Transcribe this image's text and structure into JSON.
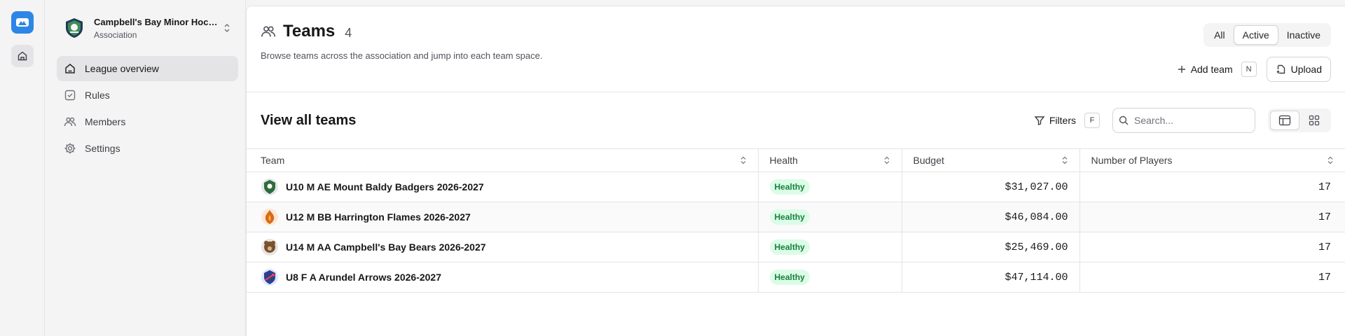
{
  "org": {
    "name": "Campbell's Bay Minor Hockey Association",
    "type": "Association"
  },
  "nav": [
    {
      "label": "League overview",
      "icon": "home-icon",
      "active": true
    },
    {
      "label": "Rules",
      "icon": "check-square-icon",
      "active": false
    },
    {
      "label": "Members",
      "icon": "users-icon",
      "active": false
    },
    {
      "label": "Settings",
      "icon": "gear-icon",
      "active": false
    }
  ],
  "header": {
    "title": "Teams",
    "count": "4",
    "subtitle": "Browse teams across the association and jump into each team space.",
    "status_filters": [
      "All",
      "Active",
      "Inactive"
    ],
    "active_status": "Active",
    "add_team_label": "Add team",
    "add_team_shortcut": "N",
    "upload_label": "Upload"
  },
  "toolbar": {
    "title": "View all teams",
    "filters_label": "Filters",
    "filters_shortcut": "F",
    "search_placeholder": "Search..."
  },
  "table": {
    "columns": [
      "Team",
      "Health",
      "Budget",
      "Number of Players"
    ],
    "rows": [
      {
        "team": "U10 M AE Mount Baldy Badgers 2026-2027",
        "health": "Healthy",
        "budget": "$31,027.00",
        "players": "17",
        "logo_color": "#2f6b3a"
      },
      {
        "team": "U12 M BB Harrington Flames 2026-2027",
        "health": "Healthy",
        "budget": "$46,084.00",
        "players": "17",
        "logo_color": "#d9681e"
      },
      {
        "team": "U14 M AA Campbell's Bay Bears 2026-2027",
        "health": "Healthy",
        "budget": "$25,469.00",
        "players": "17",
        "logo_color": "#7a5230"
      },
      {
        "team": "U8 F A Arundel Arrows 2026-2027",
        "health": "Healthy",
        "budget": "$47,114.00",
        "players": "17",
        "logo_color": "#2b3f8f"
      }
    ]
  },
  "colors": {
    "brand": "#2d86e6",
    "healthy_bg": "#dcfce7",
    "healthy_text": "#15803d"
  }
}
